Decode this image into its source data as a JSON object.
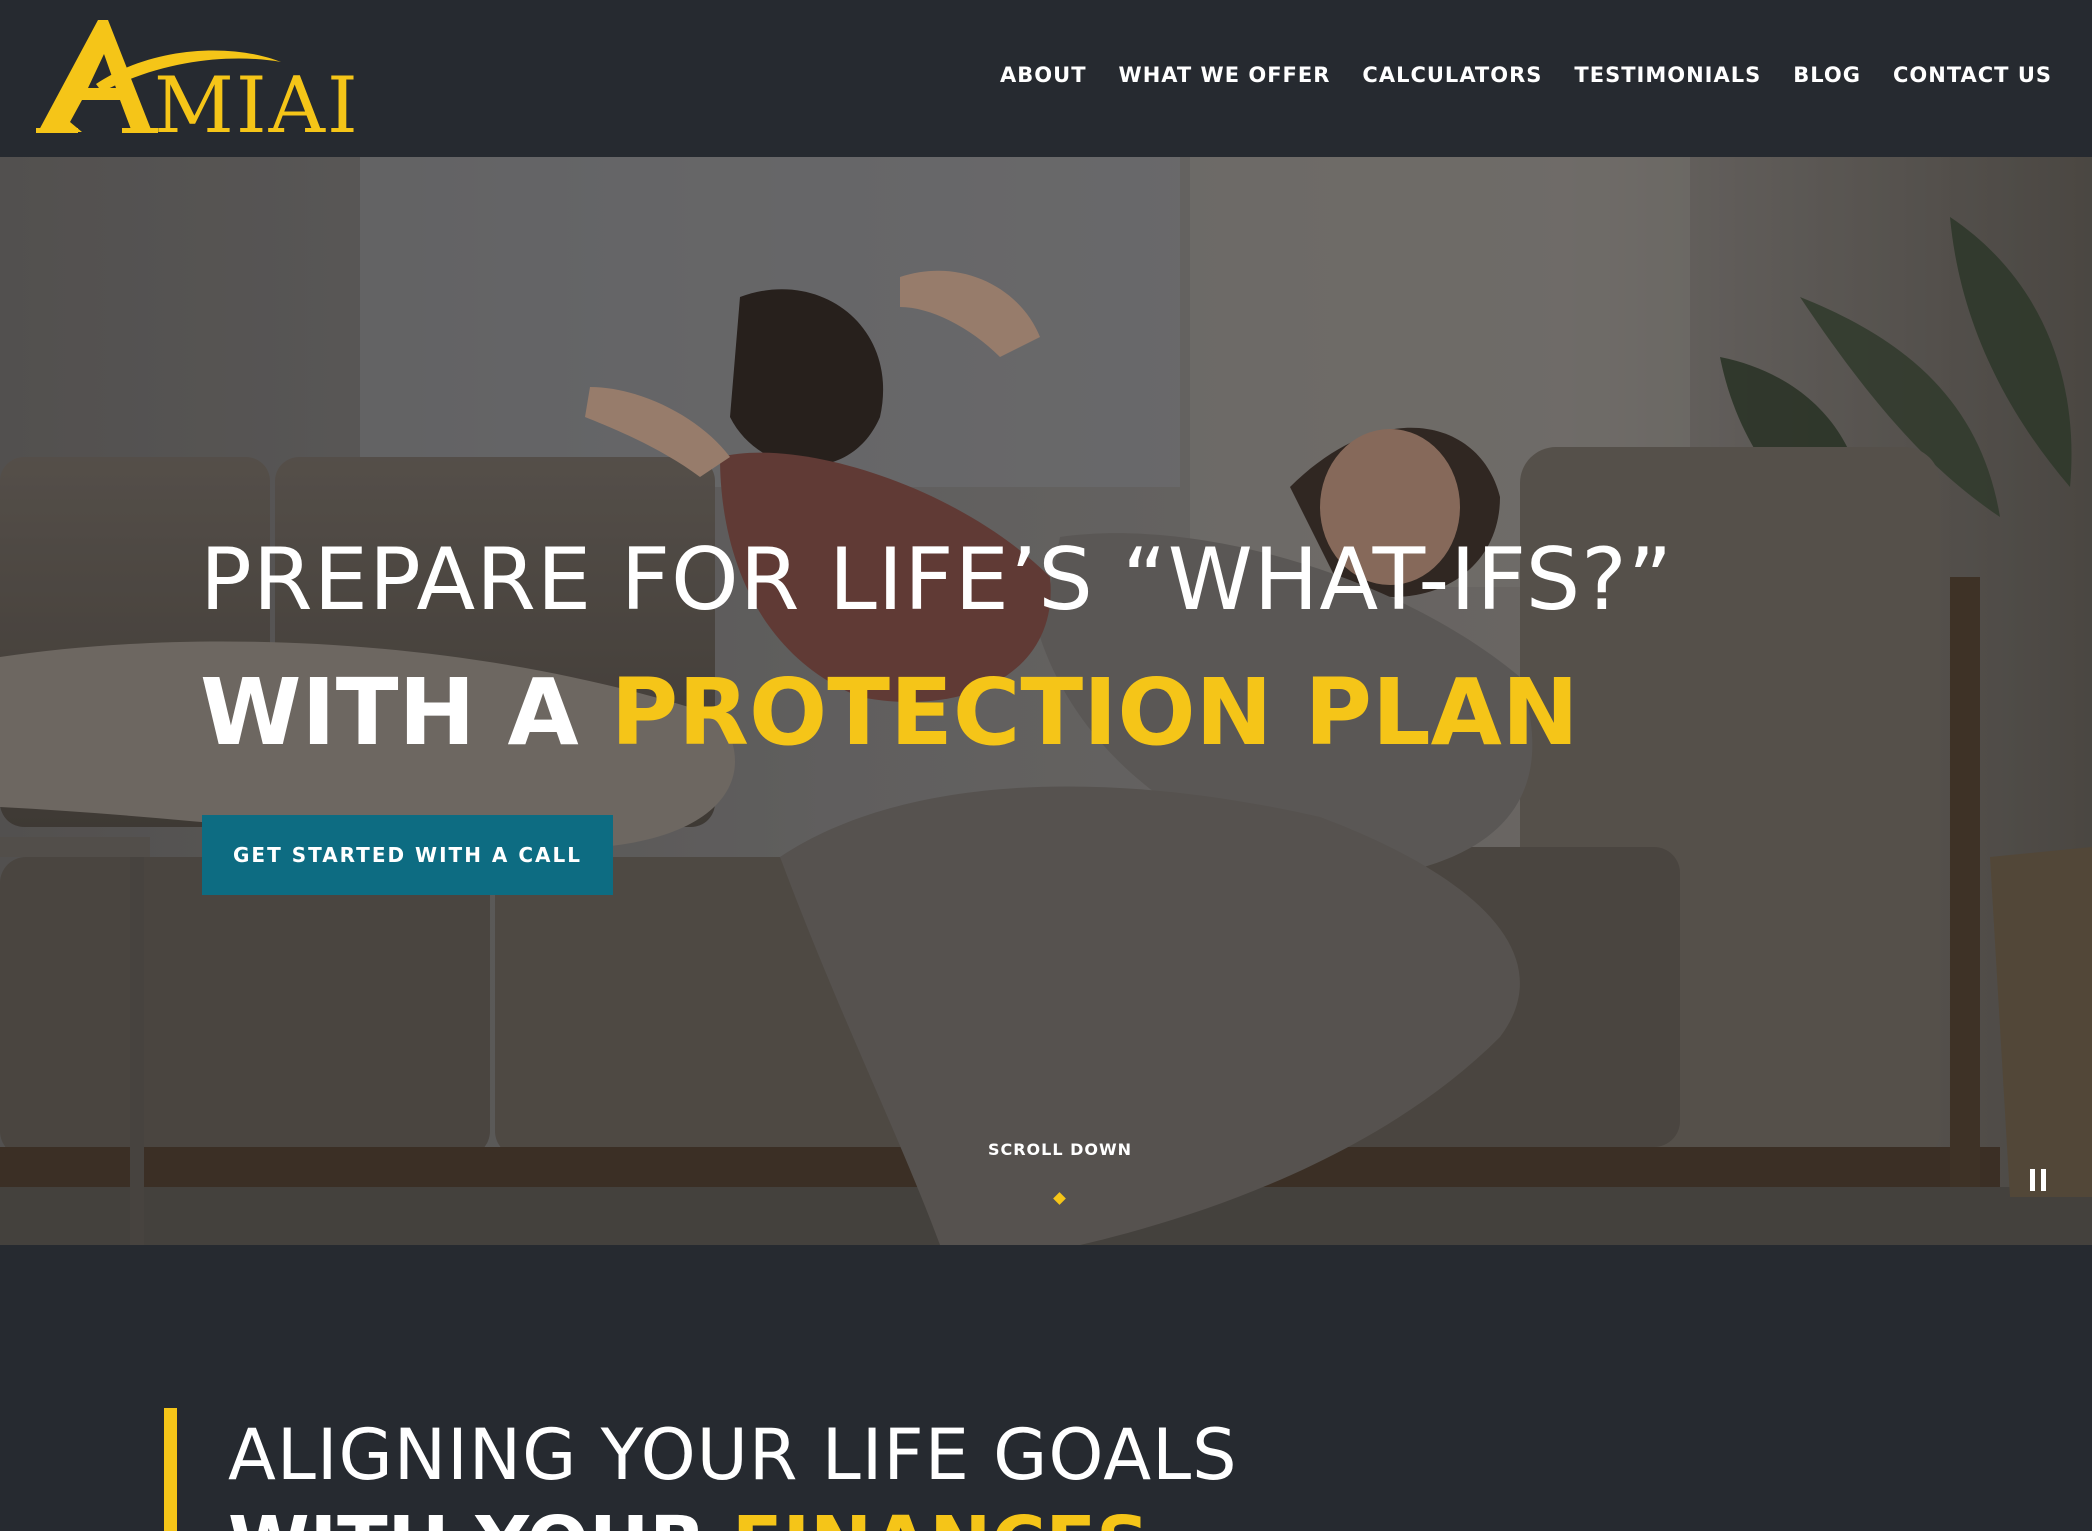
{
  "brand": {
    "logo_text": "AMIAI",
    "accent_color": "#f5c518",
    "background_color": "#262a30",
    "button_color": "#0d6c82"
  },
  "nav": {
    "items": [
      {
        "label": "ABOUT"
      },
      {
        "label": "WHAT WE OFFER"
      },
      {
        "label": "CALCULATORS"
      },
      {
        "label": "TESTIMONIALS"
      },
      {
        "label": "BLOG"
      },
      {
        "label": "CONTACT US"
      }
    ]
  },
  "hero": {
    "title_line1": "PREPARE FOR LIFE’S “WHAT-IFS?”",
    "title_line2_prefix": "WITH A ",
    "title_line2_accent": "PROTECTION PLAN",
    "cta_label": "GET STARTED WITH A CALL",
    "scroll_label": "SCROLL DOWN",
    "scroll_icon": "diamond-icon",
    "pause_icon": "pause-icon"
  },
  "section": {
    "title_line1": "ALIGNING YOUR LIFE GOALS",
    "title_line2_prefix": "WITH YOUR ",
    "title_line2_accent": "FINANCES"
  }
}
